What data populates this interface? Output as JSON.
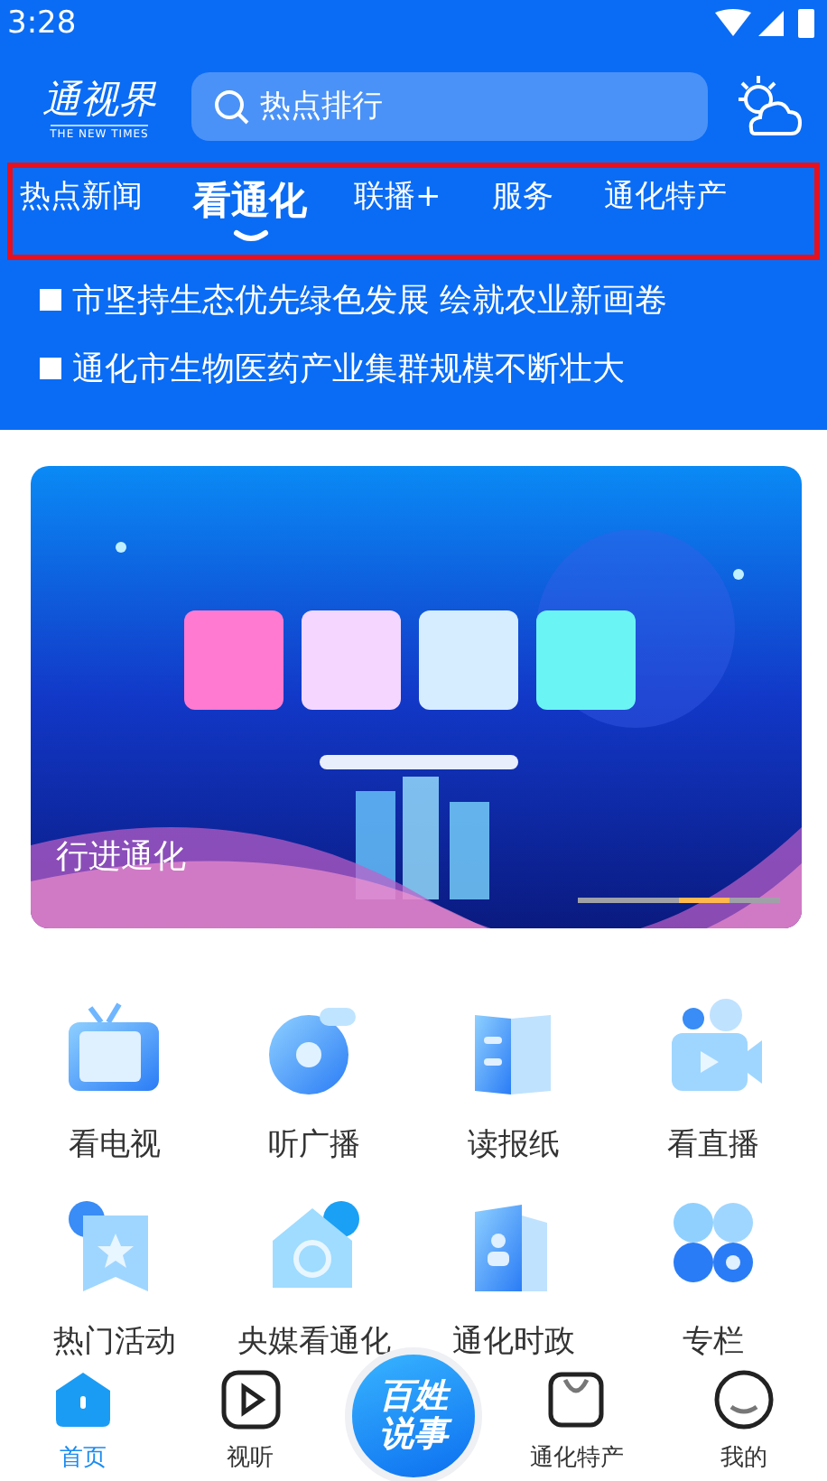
{
  "status_bar": {
    "time": "3:28"
  },
  "header": {
    "logo": {
      "title": "通视界",
      "subtitle": "THE NEW TIMES"
    },
    "search": {
      "placeholder": "热点排行"
    }
  },
  "tabs": [
    {
      "label": "热点新闻",
      "selected": false
    },
    {
      "label": "看通化",
      "selected": true
    },
    {
      "label": "联播+",
      "selected": false
    },
    {
      "label": "服务",
      "selected": false
    },
    {
      "label": "通化特产",
      "selected": false
    }
  ],
  "headlines": [
    "市坚持生态优先绿色发展 绘就农业新画卷",
    "通化市生物医药产业集群规模不断壮大"
  ],
  "banner": {
    "kind": "picture",
    "caption": "行进通化",
    "pager": [
      {
        "selected": false
      },
      {
        "selected": false
      },
      {
        "selected": true
      },
      {
        "selected": false
      }
    ]
  },
  "shortcuts": [
    {
      "label": "看电视",
      "kind": "tv"
    },
    {
      "label": "听广播",
      "kind": "radio"
    },
    {
      "label": "读报纸",
      "kind": "newspaper"
    },
    {
      "label": "看直播",
      "kind": "camera"
    },
    {
      "label": "热门活动",
      "kind": "star"
    },
    {
      "label": "央媒看通化",
      "kind": "house"
    },
    {
      "label": "通化时政",
      "kind": "person"
    },
    {
      "label": "专栏",
      "kind": "grid"
    }
  ],
  "bottom_nav": [
    {
      "label": "首页",
      "kind": "home",
      "selected": true
    },
    {
      "label": "视听",
      "kind": "play",
      "selected": false
    },
    {
      "label": "百姓说事",
      "kind": "center",
      "selected": false
    },
    {
      "label": "通化特产",
      "kind": "bag",
      "selected": false
    },
    {
      "label": "我的",
      "kind": "smile",
      "selected": false
    }
  ]
}
